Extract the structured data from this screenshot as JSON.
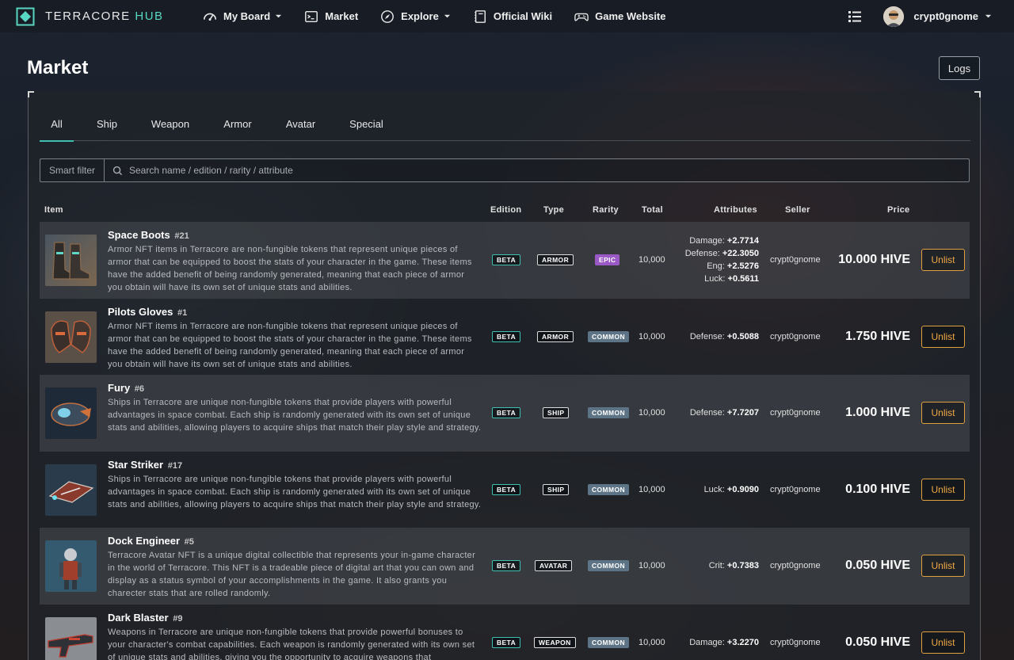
{
  "brand": {
    "name": "TERRACORE",
    "suffix": "HUB"
  },
  "nav": {
    "my_board": "My Board",
    "market": "Market",
    "explore": "Explore",
    "wiki": "Official Wiki",
    "website": "Game Website",
    "username": "crypt0gnome"
  },
  "page": {
    "title": "Market",
    "logs_label": "Logs"
  },
  "tabs": [
    "All",
    "Ship",
    "Weapon",
    "Armor",
    "Avatar",
    "Special"
  ],
  "filter": {
    "smart_label": "Smart filter",
    "search_placeholder": "Search name / edition / rarity / attribute"
  },
  "columns": {
    "item": "Item",
    "edition": "Edition",
    "type": "Type",
    "rarity": "Rarity",
    "total": "Total",
    "attributes": "Attributes",
    "seller": "Seller",
    "price": "Price"
  },
  "rows": [
    {
      "name": "Space Boots",
      "edition_no": "#21",
      "desc": "Armor NFT items in Terracore are non-fungible tokens that represent unique pieces of armor that can be equipped to boost the stats of your character in the game. These items have the added benefit of being randomly generated, meaning that each piece of armor you obtain will have its own set of unique stats and abilities.",
      "edition": "BETA",
      "type": "ARMOR",
      "rarity": "EPIC",
      "total": "10,000",
      "attributes": [
        {
          "label": "Damage:",
          "value": "+2.7714"
        },
        {
          "label": "Defense:",
          "value": "+22.3050"
        },
        {
          "label": "Eng:",
          "value": "+2.5276"
        },
        {
          "label": "Luck:",
          "value": "+0.5611"
        }
      ],
      "seller": "crypt0gnome",
      "price": "10.000 HIVE",
      "action": "Unlist"
    },
    {
      "name": "Pilots Gloves",
      "edition_no": "#1",
      "desc": "Armor NFT items in Terracore are non-fungible tokens that represent unique pieces of armor that can be equipped to boost the stats of your character in the game. These items have the added benefit of being randomly generated, meaning that each piece of armor you obtain will have its own set of unique stats and abilities.",
      "edition": "BETA",
      "type": "ARMOR",
      "rarity": "COMMON",
      "total": "10,000",
      "attributes": [
        {
          "label": "Defense:",
          "value": "+0.5088"
        }
      ],
      "seller": "crypt0gnome",
      "price": "1.750 HIVE",
      "action": "Unlist"
    },
    {
      "name": "Fury",
      "edition_no": "#6",
      "desc": "Ships in Terracore are unique non-fungible tokens that provide players with powerful advantages in space combat. Each ship is randomly generated with its own set of unique stats and abilities, allowing players to acquire ships that match their play style and strategy.",
      "edition": "BETA",
      "type": "SHIP",
      "rarity": "COMMON",
      "total": "10,000",
      "attributes": [
        {
          "label": "Defense:",
          "value": "+7.7207"
        }
      ],
      "seller": "crypt0gnome",
      "price": "1.000 HIVE",
      "action": "Unlist"
    },
    {
      "name": "Star Striker",
      "edition_no": "#17",
      "desc": "Ships in Terracore are unique non-fungible tokens that provide players with powerful advantages in space combat. Each ship is randomly generated with its own set of unique stats and abilities, allowing players to acquire ships that match their play style and strategy.",
      "edition": "BETA",
      "type": "SHIP",
      "rarity": "COMMON",
      "total": "10,000",
      "attributes": [
        {
          "label": "Luck:",
          "value": "+0.9090"
        }
      ],
      "seller": "crypt0gnome",
      "price": "0.100 HIVE",
      "action": "Unlist"
    },
    {
      "name": "Dock Engineer",
      "edition_no": "#5",
      "desc": "Terracore Avatar NFT is a unique digital collectible that represents your in-game character in the world of Terracore. This NFT is a tradeable piece of digital art that you can own and display as a status symbol of your accomplishments in the game. It also grants you charecter stats that are rolled randomly.",
      "edition": "BETA",
      "type": "AVATAR",
      "rarity": "COMMON",
      "total": "10,000",
      "attributes": [
        {
          "label": "Crit:",
          "value": "+0.7383"
        }
      ],
      "seller": "crypt0gnome",
      "price": "0.050 HIVE",
      "action": "Unlist"
    },
    {
      "name": "Dark Blaster",
      "edition_no": "#9",
      "desc": "Weapons in Terracore are unique non-fungible tokens that provide powerful bonuses to your character's combat capabilities. Each weapon is randomly generated with its own set of unique stats and abilities, giving you the opportunity to acquire weapons that",
      "edition": "BETA",
      "type": "WEAPON",
      "rarity": "COMMON",
      "total": "10,000",
      "attributes": [
        {
          "label": "Damage:",
          "value": "+3.2270"
        }
      ],
      "seller": "crypt0gnome",
      "price": "0.050 HIVE",
      "action": "Unlist"
    }
  ],
  "colors": {
    "accent": "#3fbfb0",
    "unlist": "#f0a844",
    "epic": "#9b59c6",
    "common": "#5c7486"
  }
}
